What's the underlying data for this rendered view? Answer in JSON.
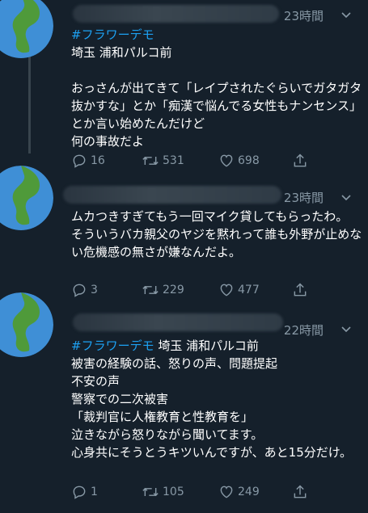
{
  "tweets": [
    {
      "time": "23時間",
      "hashtag": "#フラワーデモ",
      "location": "埼玉 浦和パルコ前",
      "text": "おっさんが出てきて「レイプされたぐらいでガタガタ抜かすな」とか「痴漢で悩んでる女性もナンセンス」とか言い始めたんだけど\n何の事故だよ",
      "replies": "16",
      "retweets": "531",
      "likes": "698"
    },
    {
      "time": "23時間",
      "text": "ムカつきすぎてもう一回マイク貸してもらったわ。\nそういうバカ親父のヤジを黙れって誰も外野が止めない危機感の無さが嫌なんだよ。",
      "replies": "3",
      "retweets": "229",
      "likes": "477"
    },
    {
      "time": "22時間",
      "hashtag": "#フラワーデモ",
      "location": " 埼玉 浦和パルコ前",
      "text": "被害の経験の話、怒りの声、問題提起\n不安の声\n警察での二次被害\n「裁判官に人権教育と性教育を」\n泣きながら怒りながら聞いてます。\n心身共にそうとうキツいんですが、あと15分だけ。",
      "replies": "1",
      "retweets": "105",
      "likes": "249"
    }
  ],
  "colors": {
    "background": "#15202b",
    "text": "#ffffff",
    "secondary": "#8899a6",
    "link": "#1da1f2"
  }
}
